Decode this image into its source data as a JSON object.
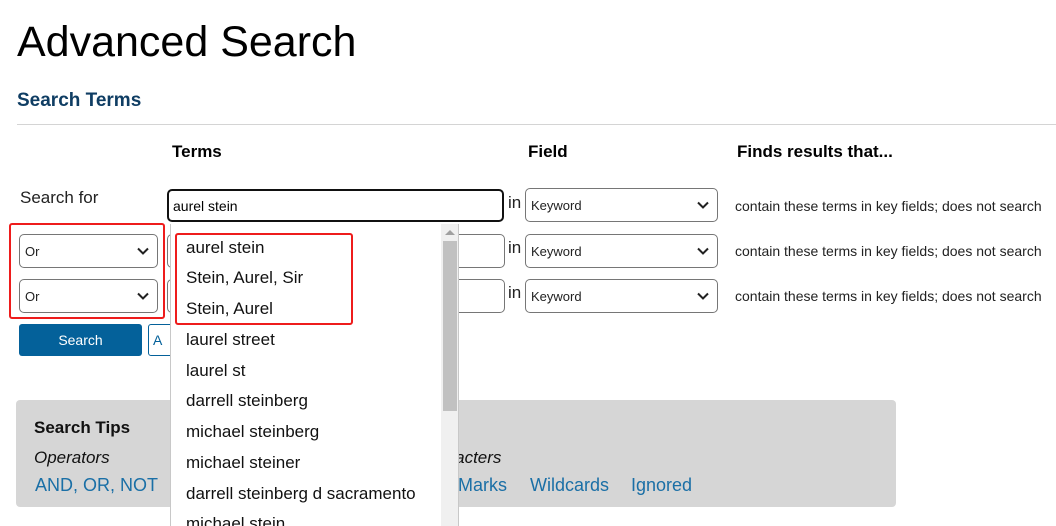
{
  "page": {
    "title": "Advanced Search",
    "section_title": "Search Terms"
  },
  "columns": {
    "terms": "Terms",
    "field": "Field",
    "finds": "Finds results that..."
  },
  "rows": [
    {
      "label": "Search for",
      "operator": null,
      "term_value": "aurel stein",
      "in_label": "in",
      "field": "Keyword",
      "finds": "contain these terms in key fields; does not search"
    },
    {
      "label": null,
      "operator": "Or",
      "term_value": "",
      "in_label": "in",
      "field": "Keyword",
      "finds": "contain these terms in key fields; does not search"
    },
    {
      "label": null,
      "operator": "Or",
      "term_value": "",
      "in_label": "in",
      "field": "Keyword",
      "finds": "contain these terms in key fields; does not search"
    }
  ],
  "buttons": {
    "search": "Search",
    "advanced_partial": "A"
  },
  "autocomplete": {
    "items": [
      "aurel stein",
      "Stein, Aurel, Sir",
      "Stein, Aurel",
      "laurel street",
      "laurel st",
      "darrell steinberg",
      "michael steinberg",
      "michael steiner",
      "darrell steinberg d sacramento",
      "michael stein"
    ]
  },
  "tips": {
    "title": "Search Tips",
    "operators_heading": "Operators",
    "characters_heading": "aracters",
    "links": [
      "AND, OR, NOT",
      "Marks",
      "Wildcards",
      "Ignored"
    ]
  },
  "colors": {
    "brand_blue": "#04619a",
    "heading_blue": "#0f3d63",
    "link_blue": "#1a6fa6",
    "highlight_red": "#ee1c1c",
    "tips_bg": "#d6d6d6"
  }
}
